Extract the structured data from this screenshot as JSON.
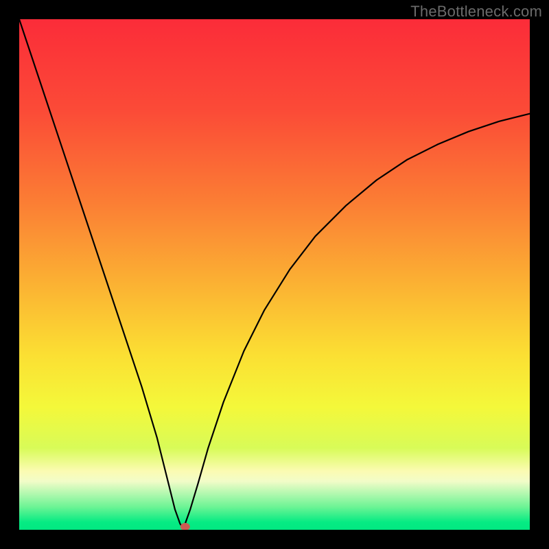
{
  "watermark": "TheBottleneck.com",
  "chart_data": {
    "type": "line",
    "title": "",
    "xlabel": "",
    "ylabel": "",
    "xlim": [
      0,
      100
    ],
    "ylim": [
      0,
      100
    ],
    "grid": false,
    "legend": false,
    "series": [
      {
        "name": "curve",
        "x": [
          0,
          2,
          5,
          8,
          12,
          16,
          20,
          24,
          27,
          29,
          30.5,
          31.5,
          32.0,
          32.5,
          33.5,
          35.0,
          37.0,
          40.0,
          44.0,
          48.0,
          53.0,
          58.0,
          64.0,
          70.0,
          76.0,
          82.0,
          88.0,
          94.0,
          100.0
        ],
        "y": [
          100,
          94,
          85,
          76,
          64,
          52,
          40,
          28,
          18,
          10,
          4.0,
          1.2,
          0.4,
          1.2,
          4.0,
          9.0,
          16.0,
          25.0,
          35.0,
          43.0,
          51.0,
          57.5,
          63.5,
          68.5,
          72.5,
          75.5,
          78.0,
          80.0,
          81.5
        ]
      }
    ],
    "marker": {
      "x": 32.5,
      "y": 0.6,
      "color": "#cd5b52"
    },
    "background_gradient": {
      "stops": [
        {
          "offset": 0.0,
          "color": "#fb2c39"
        },
        {
          "offset": 0.18,
          "color": "#fb4b37"
        },
        {
          "offset": 0.36,
          "color": "#fb7e34"
        },
        {
          "offset": 0.52,
          "color": "#fbb233"
        },
        {
          "offset": 0.66,
          "color": "#fbe033"
        },
        {
          "offset": 0.76,
          "color": "#f4f83a"
        },
        {
          "offset": 0.84,
          "color": "#d8fb58"
        },
        {
          "offset": 0.885,
          "color": "#fbfbb2"
        },
        {
          "offset": 0.905,
          "color": "#f2fcc8"
        },
        {
          "offset": 0.955,
          "color": "#6df495"
        },
        {
          "offset": 0.985,
          "color": "#06eb83"
        },
        {
          "offset": 1.0,
          "color": "#02e882"
        }
      ]
    }
  }
}
